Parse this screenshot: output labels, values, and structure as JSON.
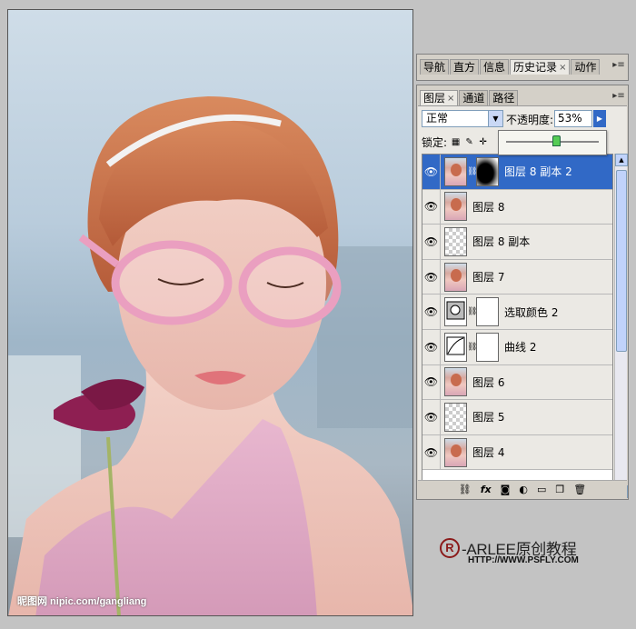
{
  "canvas": {
    "watermark": "昵图网 nipic.com/gangliang"
  },
  "history_panel": {
    "tabs": [
      {
        "label": "导航"
      },
      {
        "label": "直方"
      },
      {
        "label": "信息"
      },
      {
        "label": "历史记录",
        "close": "×",
        "active": true
      },
      {
        "label": "动作"
      }
    ],
    "menu_icon": "panel-menu-icon"
  },
  "layers_panel": {
    "tabs": [
      {
        "label": "图层",
        "close": "×",
        "active": true
      },
      {
        "label": "通道"
      },
      {
        "label": "路径"
      }
    ],
    "blend_mode": "正常",
    "opacity_label": "不透明度:",
    "opacity_value": "53%",
    "opacity_slider_value": 0.53,
    "lock_label": "锁定:",
    "layers": [
      {
        "name": "图层 8 副本 2",
        "thumb": "photo",
        "mask": true,
        "selected": true
      },
      {
        "name": "图层 8",
        "thumb": "photo"
      },
      {
        "name": "图层 8 副本",
        "thumb": "checker"
      },
      {
        "name": "图层 7",
        "thumb": "photo"
      },
      {
        "name": "选取颜色 2",
        "thumb": "adjust-levels",
        "mask": true
      },
      {
        "name": "曲线 2",
        "thumb": "adjust-curves",
        "mask": true
      },
      {
        "name": "图层 6",
        "thumb": "photo"
      },
      {
        "name": "图层 5",
        "thumb": "checker"
      },
      {
        "name": "图层 4",
        "thumb": "photo"
      }
    ],
    "bottom_icons": [
      "link-icon",
      "fx-icon",
      "mask-icon",
      "adjustment-icon",
      "folder-icon",
      "new-layer-icon",
      "trash-icon"
    ],
    "fx_label": "fx"
  },
  "logo": {
    "mark": "R",
    "name": "-ARLEE原创教程",
    "url": "HTTP://WWW.PSFLY.COM"
  }
}
